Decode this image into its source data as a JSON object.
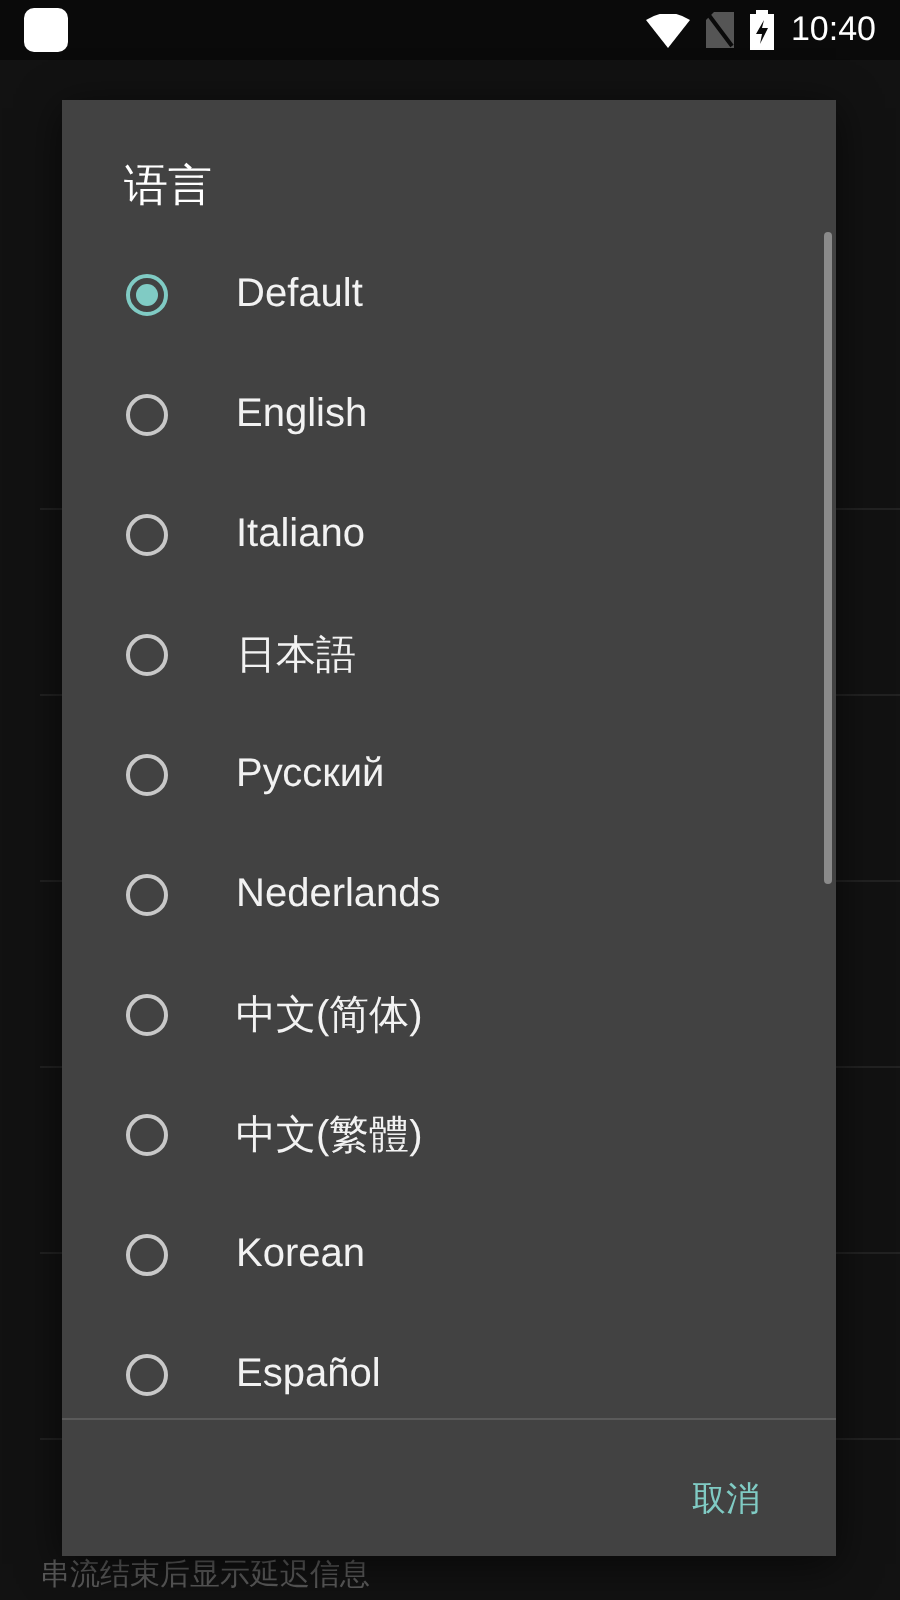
{
  "status_bar": {
    "time": "10:40"
  },
  "settings": [
    {
      "kind": "item",
      "summary": "串流结束后显示延迟信息"
    }
  ],
  "dialog": {
    "title": "语言",
    "options": [
      {
        "label": "Default",
        "selected": true
      },
      {
        "label": "English",
        "selected": false
      },
      {
        "label": "Italiano",
        "selected": false
      },
      {
        "label": "日本語",
        "selected": false
      },
      {
        "label": "Русский",
        "selected": false
      },
      {
        "label": "Nederlands",
        "selected": false
      },
      {
        "label": "中文(简体)",
        "selected": false
      },
      {
        "label": "中文(繁體)",
        "selected": false
      },
      {
        "label": "Korean",
        "selected": false
      },
      {
        "label": "Español",
        "selected": false
      }
    ],
    "cancel": "取消"
  }
}
